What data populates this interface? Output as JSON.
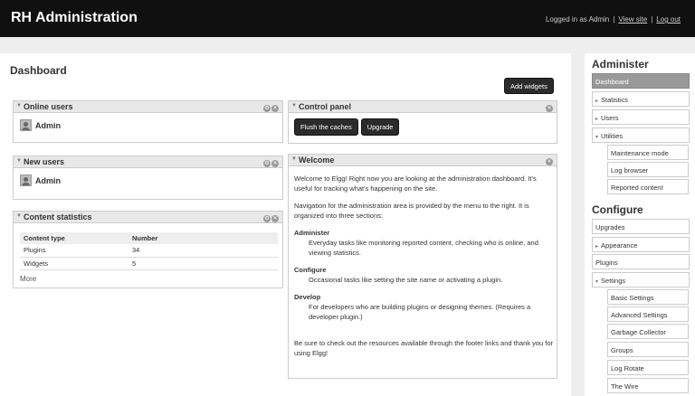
{
  "header": {
    "title": "RH Administration",
    "logged_in_text": "Logged in as Admin",
    "view_site_label": "View site",
    "logout_label": "Log out"
  },
  "dashboard": {
    "page_title": "Dashboard",
    "add_widgets_label": "Add widgets",
    "online_users": {
      "title": "Online users",
      "users": [
        "Admin"
      ]
    },
    "new_users": {
      "title": "New users",
      "users": [
        "Admin"
      ]
    },
    "content_statistics": {
      "title": "Content statistics",
      "columns": [
        "Content type",
        "Number"
      ],
      "rows": [
        {
          "type": "Plugins",
          "number": "34"
        },
        {
          "type": "Widgets",
          "number": "5"
        }
      ],
      "more_label": "More"
    },
    "control_panel": {
      "title": "Control panel",
      "flush_label": "Flush the caches",
      "upgrade_label": "Upgrade"
    },
    "welcome": {
      "title": "Welcome",
      "intro": "Welcome to Elgg! Right now you are looking at the administration dashboard. It's useful for tracking what's happening on the site.",
      "nav_text": "Navigation for the administration area is provided by the menu to the right. It is organized into three sections:",
      "sections": [
        {
          "name": "Administer",
          "desc": "Everyday tasks like monitoring reported content, checking who is online, and viewing statistics."
        },
        {
          "name": "Configure",
          "desc": "Occasional tasks like setting the site name or activating a plugin."
        },
        {
          "name": "Develop",
          "desc": "For developers who are building plugins or designing themes. (Requires a developer plugin.)"
        }
      ],
      "footer_text": "Be sure to check out the resources available through the footer links and thank you for using Elgg!"
    }
  },
  "sidebar": {
    "administer_heading": "Administer",
    "administer_items": [
      {
        "label": "Dashboard",
        "selected": true
      },
      {
        "label": "Statistics",
        "expander": "▸"
      },
      {
        "label": "Users",
        "expander": "▸"
      },
      {
        "label": "Utilities",
        "expander": "▾"
      }
    ],
    "utilities_items": [
      "Maintenance mode",
      "Log browser",
      "Reported content"
    ],
    "configure_heading": "Configure",
    "configure_items": [
      {
        "label": "Upgrades"
      },
      {
        "label": "Appearance",
        "expander": "▸"
      },
      {
        "label": "Plugins"
      },
      {
        "label": "Settings",
        "expander": "▾"
      }
    ],
    "settings_items": [
      "Basic Settings",
      "Advanced Settings",
      "Garbage Collector",
      "Groups",
      "Log Rotate",
      "The Wire"
    ]
  },
  "colors": {
    "topbar": "#101010",
    "button_dark": "#2b2b2b",
    "selected_menu": "#999999",
    "background": "#eeeeee"
  }
}
